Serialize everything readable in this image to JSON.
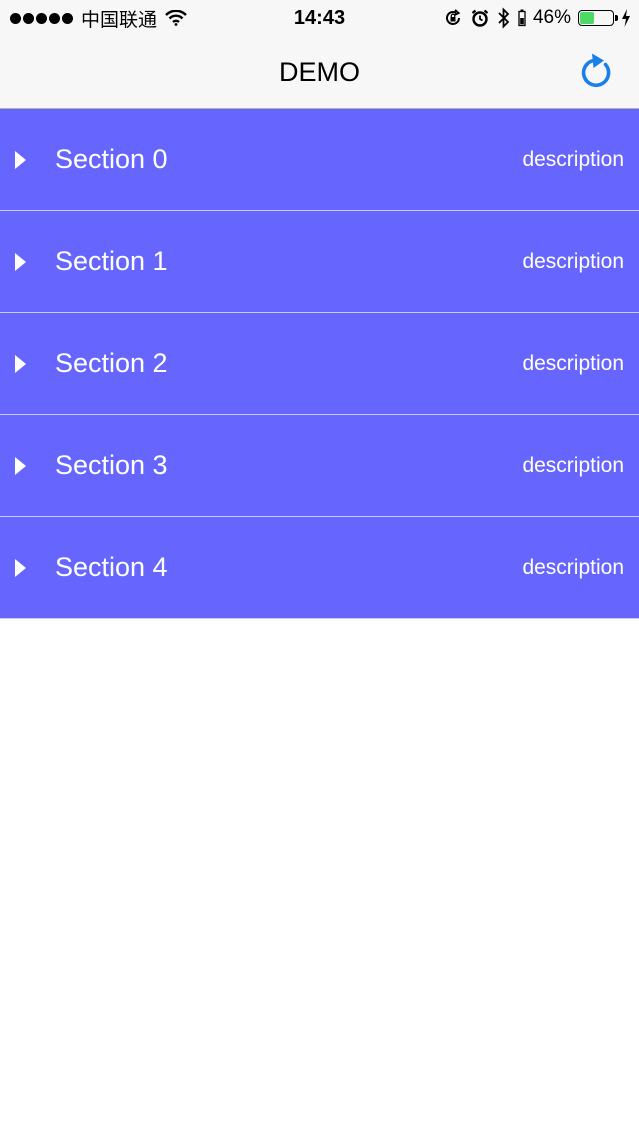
{
  "status_bar": {
    "carrier": "中国联通",
    "time": "14:43",
    "battery_percent": "46%",
    "battery_level": 0.46,
    "icons": [
      "signal-dots-icon",
      "wifi-icon",
      "orientation-lock-icon",
      "alarm-icon",
      "bluetooth-icon",
      "battery-icon",
      "charging-icon"
    ]
  },
  "nav": {
    "title": "DEMO",
    "refresh_icon": "refresh-icon",
    "accent_color": "#1a7fe8"
  },
  "theme": {
    "section_background": "#6666ff",
    "section_text": "#ffffff"
  },
  "sections": [
    {
      "title": "Section 0",
      "description": "description"
    },
    {
      "title": "Section 1",
      "description": "description"
    },
    {
      "title": "Section 2",
      "description": "description"
    },
    {
      "title": "Section 3",
      "description": "description"
    },
    {
      "title": "Section 4",
      "description": "description"
    }
  ]
}
